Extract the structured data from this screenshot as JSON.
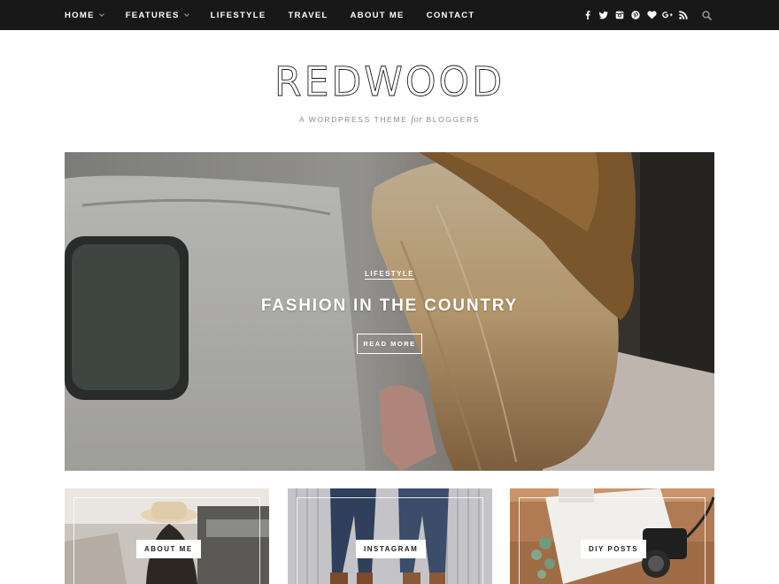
{
  "nav": {
    "items": [
      {
        "label": "Home",
        "has_dropdown": true
      },
      {
        "label": "Features",
        "has_dropdown": true
      },
      {
        "label": "Lifestyle",
        "has_dropdown": false
      },
      {
        "label": "Travel",
        "has_dropdown": false
      },
      {
        "label": "About Me",
        "has_dropdown": false
      },
      {
        "label": "Contact",
        "has_dropdown": false
      }
    ],
    "social_icons": [
      "facebook-icon",
      "twitter-icon",
      "instagram-icon",
      "pinterest-icon",
      "bloglovin-heart-icon",
      "google-plus-icon",
      "rss-icon"
    ],
    "search_icon": "search-icon"
  },
  "header": {
    "logo": "REDWOOD",
    "tagline_before": "A WordPress Theme",
    "tagline_for": "for",
    "tagline_after": "Bloggers"
  },
  "hero": {
    "category": "Lifestyle",
    "title": "Fashion in the Country",
    "button": "Read More"
  },
  "promos": [
    {
      "label": "About Me"
    },
    {
      "label": "Instagram"
    },
    {
      "label": "DIY Posts"
    }
  ],
  "colors": {
    "topbar": "#181818",
    "text": "#222222",
    "muted": "#8a8a8a"
  }
}
